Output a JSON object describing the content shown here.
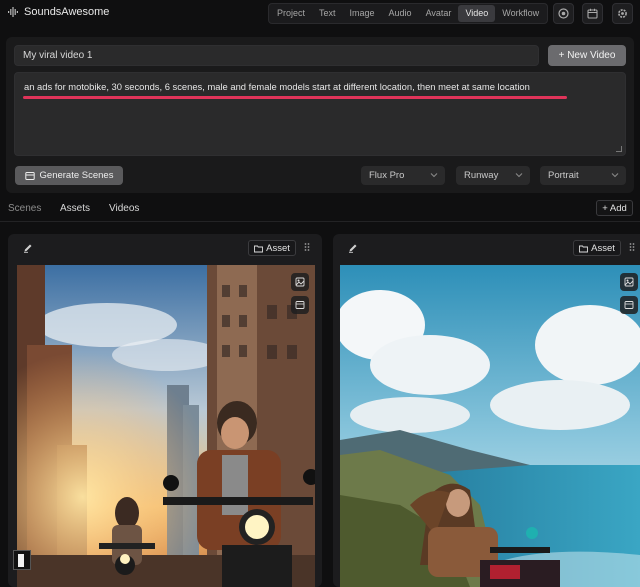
{
  "app": {
    "name": "SoundsAwesome"
  },
  "nav": {
    "tabs": [
      {
        "label": "Project"
      },
      {
        "label": "Text"
      },
      {
        "label": "Image"
      },
      {
        "label": "Audio"
      },
      {
        "label": "Avatar"
      },
      {
        "label": "Video",
        "active": true
      },
      {
        "label": "Workflow"
      }
    ]
  },
  "project": {
    "title_value": "My viral video 1",
    "new_video_label": "+ New Video",
    "prompt_value": "an ads for motobike, 30 seconds, 6 scenes, male and female models start at different location, then meet at same location",
    "generate_label": "Generate Scenes"
  },
  "selects": {
    "image_model": "Flux Pro",
    "video_model": "Runway",
    "orientation": "Portrait"
  },
  "subtabs": {
    "scenes": "Scenes",
    "assets": "Assets",
    "videos": "Videos",
    "add_label": "+ Add"
  },
  "scenes": [
    {
      "asset_label": "Asset",
      "image": "city-street-motorcycle-riders"
    },
    {
      "asset_label": "Asset",
      "image": "coastal-cliff-motorcycle-rider"
    }
  ],
  "colors": {
    "background": "#0f0f10",
    "panel": "#1a1a1b",
    "spellcheck_underline": "#e0345a",
    "active_tab": "#3a3a3e"
  }
}
